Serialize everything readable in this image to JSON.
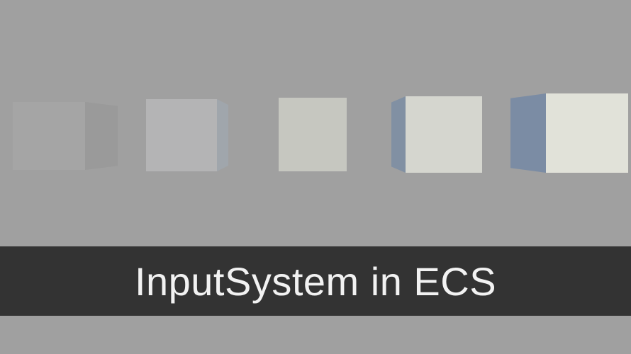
{
  "title": "InputSystem in ECS",
  "colors": {
    "background": "#a0a0a0",
    "bar_background": "#333333",
    "title_text": "#f2f2f2",
    "cube1_front": "#a5a5a5",
    "cube1_side": "#9a9a9a",
    "cube2_front": "#b4b4b5",
    "cube2_side": "#a0a6ac",
    "cube3_front": "#c6c7c0",
    "cube4_side": "#8190a3",
    "cube4_front": "#d5d6cf",
    "cube5_side": "#7b8ca4",
    "cube5_front": "#e1e2d9"
  }
}
